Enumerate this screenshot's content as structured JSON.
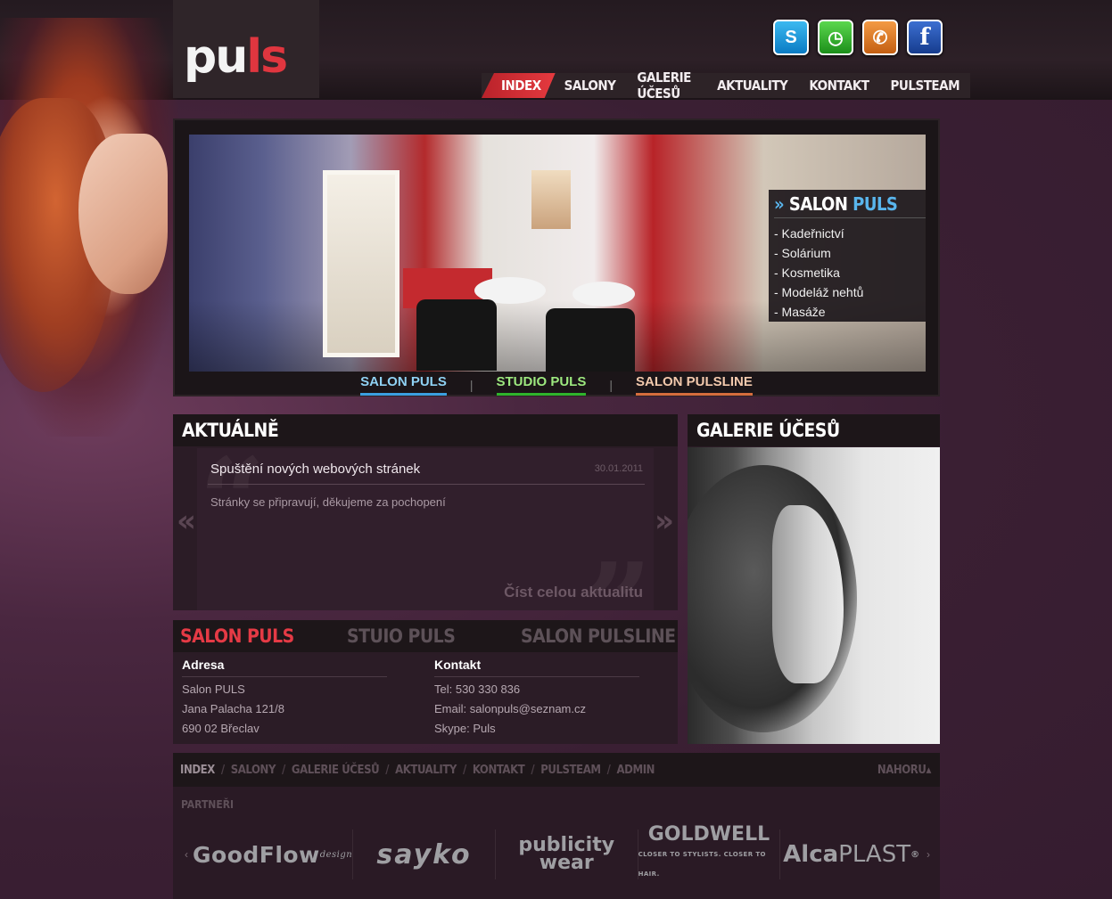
{
  "header": {
    "logo": {
      "part1": "pu",
      "part2": "ls"
    },
    "social": [
      {
        "name": "skype-icon",
        "glyph": "S",
        "color": "#0a7bc4"
      },
      {
        "name": "clock-icon",
        "glyph": "◷",
        "color": "#1c8f1a"
      },
      {
        "name": "phone-icon",
        "glyph": "✆",
        "color": "#c45f12"
      },
      {
        "name": "facebook-icon",
        "glyph": "f",
        "color": "#163c8e"
      }
    ],
    "nav": [
      "INDEX",
      "SALONY",
      "GALERIE ÚČESŮ",
      "AKTUALITY",
      "KONTAKT",
      "PULSTEAM"
    ]
  },
  "slider": {
    "box_title_prefix": "»",
    "box_title_main": "SALON",
    "box_title_highlight": "PULS",
    "services": [
      "- Kadeřnictví",
      "- Solárium",
      "- Kosmetika",
      "- Modeláž nehtů",
      "- Masáže"
    ],
    "tabs": [
      "SALON PULS",
      "STUDIO PULS",
      "SALON PULSLINE"
    ],
    "separator": "|"
  },
  "news": {
    "heading": "AKTUÁLNĚ",
    "title": "Spuštění nových webových stránek",
    "date": "30.01.2011",
    "text": "Stránky se připravují, děkujeme za pochopení",
    "more": "Číst celou aktualitu",
    "prev": "«",
    "next": "»"
  },
  "gallery": {
    "heading": "GALERIE ÚČESŮ"
  },
  "contact": {
    "tabs": [
      "SALON PULS",
      "STUIO PULS",
      "SALON PULSLINE"
    ],
    "address": {
      "heading": "Adresa",
      "lines": [
        "Salon PULS",
        "Jana Palacha 121/8",
        "690 02 Břeclav"
      ]
    },
    "contact": {
      "heading": "Kontakt",
      "lines": [
        "Tel: 530 330 836",
        "Email: salonpuls@seznam.cz",
        "Skype: Puls"
      ]
    }
  },
  "footer": {
    "nav": [
      "INDEX",
      "SALONY",
      "GALERIE ÚČESŮ",
      "AKTUALITY",
      "KONTAKT",
      "PULSTEAM",
      "ADMIN"
    ],
    "top": "NAHORU▴",
    "partners_label": "PARTNEŘI",
    "partners": {
      "goodflow": "GoodFlow",
      "goodflow_sub": "design",
      "sayko": "sayko",
      "publicity_1": "publicity",
      "publicity_2": "wear",
      "goldwell": "GOLDWELL",
      "goldwell_sub": "CLOSER TO STYLISTS. CLOSER TO HAIR.",
      "alca_1": "Alca",
      "alca_2": "PLAST",
      "alca_mark": "®"
    },
    "arrow_left": "‹",
    "arrow_right": "›"
  }
}
